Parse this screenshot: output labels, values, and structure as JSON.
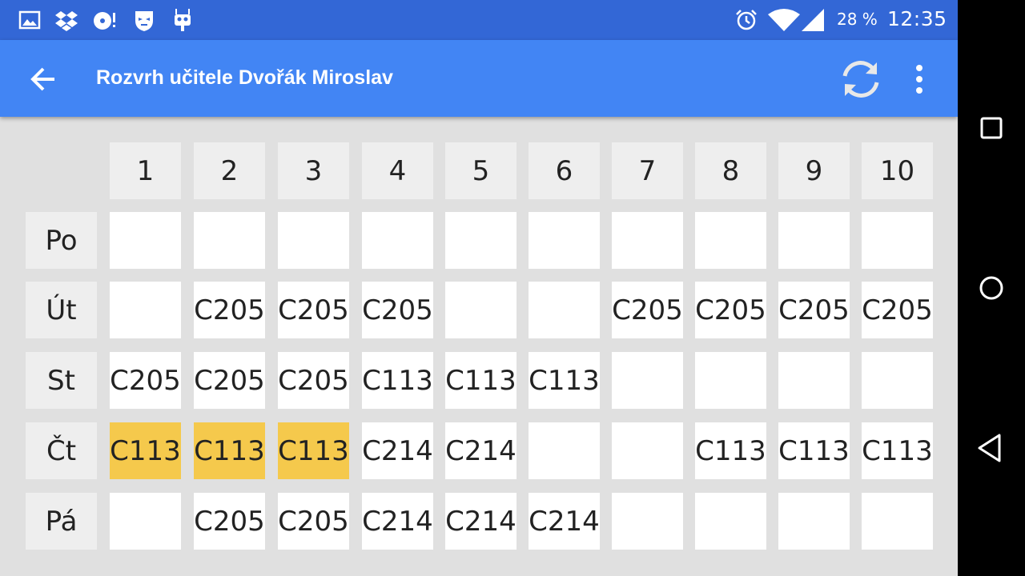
{
  "status_bar": {
    "battery": "28 %",
    "time": "12:35",
    "icons": [
      "image-icon",
      "dropbox-icon",
      "disc-alert-icon",
      "shield-face-icon",
      "android-robot-icon",
      "alarm-icon",
      "wifi-icon",
      "signal-icon"
    ]
  },
  "app_bar": {
    "title": "Rozvrh učitele Dvořák Miroslav",
    "icons": [
      "back-arrow-icon",
      "refresh-icon",
      "more-vert-icon"
    ]
  },
  "timetable": {
    "periods": [
      "1",
      "2",
      "3",
      "4",
      "5",
      "6",
      "7",
      "8",
      "9",
      "10"
    ],
    "highlight_color": "#f5c94c",
    "days": [
      {
        "label": "Po",
        "slots": [
          "",
          "",
          "",
          "",
          "",
          "",
          "",
          "",
          "",
          ""
        ],
        "highlighted": []
      },
      {
        "label": "Út",
        "slots": [
          "",
          "C205",
          "C205",
          "C205",
          "",
          "",
          "C205",
          "C205",
          "C205",
          "C205"
        ],
        "highlighted": []
      },
      {
        "label": "St",
        "slots": [
          "C205",
          "C205",
          "C205",
          "C113",
          "C113",
          "C113",
          "",
          "",
          "",
          ""
        ],
        "highlighted": []
      },
      {
        "label": "Čt",
        "slots": [
          "C113",
          "C113",
          "C113",
          "C214",
          "C214",
          "",
          "",
          "C113",
          "C113",
          "C113"
        ],
        "highlighted": [
          0,
          1,
          2
        ]
      },
      {
        "label": "Pá",
        "slots": [
          "",
          "C205",
          "C205",
          "C214",
          "C214",
          "C214",
          "",
          "",
          "",
          ""
        ],
        "highlighted": []
      }
    ]
  },
  "nav_bar": {
    "icons": [
      "recents-square-icon",
      "home-circle-icon",
      "back-triangle-icon"
    ]
  }
}
